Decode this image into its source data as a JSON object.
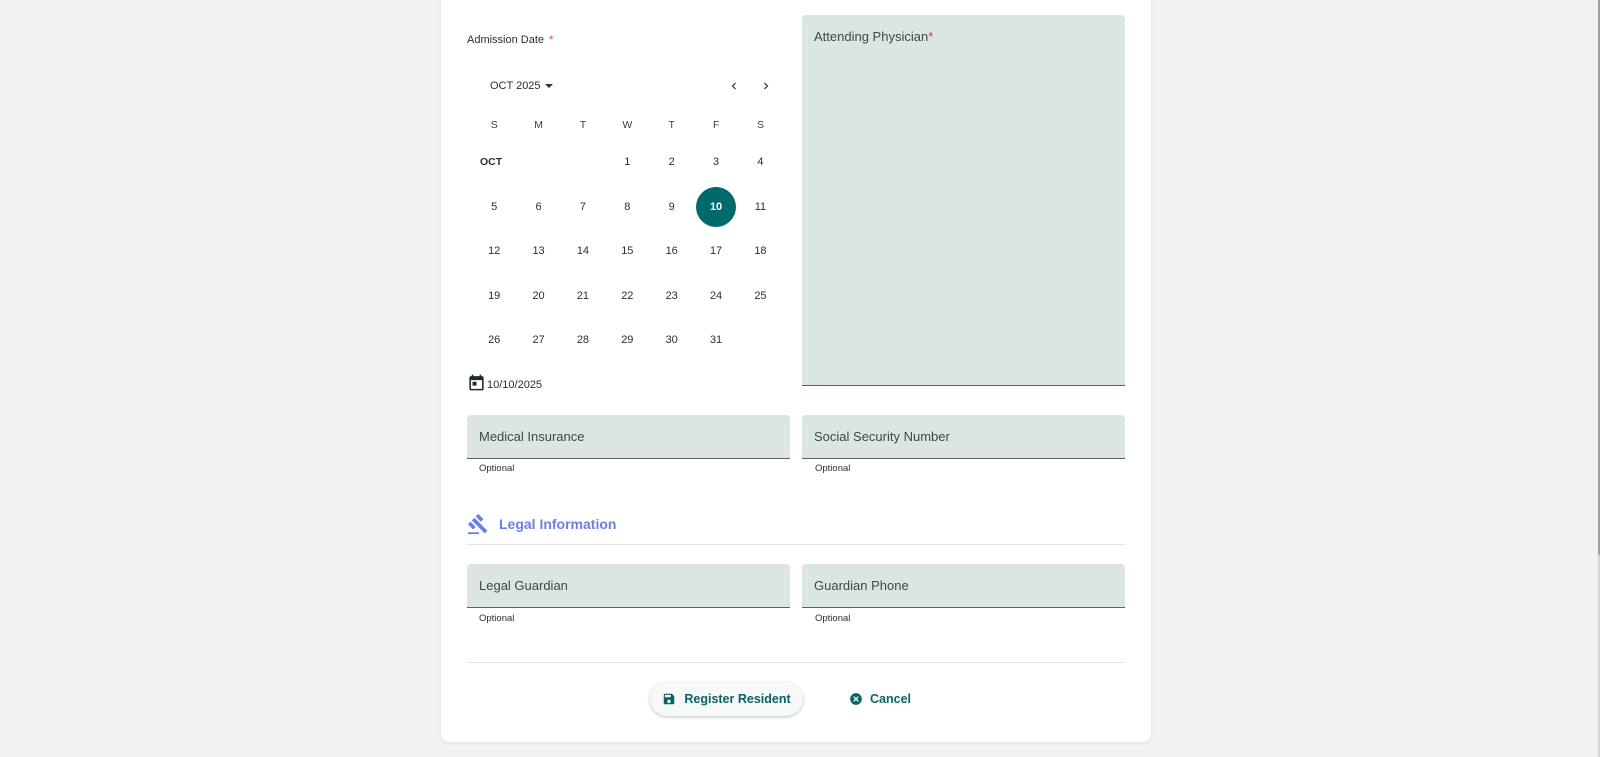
{
  "admission": {
    "label": "Admission Date",
    "required_mark": "*",
    "month_label": "OCT 2025",
    "month_tag": "OCT",
    "weekdays": [
      "S",
      "M",
      "T",
      "W",
      "T",
      "F",
      "S"
    ],
    "weeks": [
      [
        "",
        "",
        "",
        "1",
        "2",
        "3",
        "4"
      ],
      [
        "5",
        "6",
        "7",
        "8",
        "9",
        "10",
        "11"
      ],
      [
        "12",
        "13",
        "14",
        "15",
        "16",
        "17",
        "18"
      ],
      [
        "19",
        "20",
        "21",
        "22",
        "23",
        "24",
        "25"
      ],
      [
        "26",
        "27",
        "28",
        "29",
        "30",
        "31",
        ""
      ]
    ],
    "selected_day": "10",
    "value": "10/10/2025",
    "icons": {
      "prev": "chevron-left-icon",
      "next": "chevron-right-icon",
      "calendar": "calendar-icon",
      "dropdown": "caret-down-icon"
    }
  },
  "fields": {
    "attending_physician": {
      "label": "Attending Physician",
      "required_mark": "*"
    },
    "medical_insurance": {
      "label": "Medical Insurance",
      "helper": "Optional"
    },
    "ssn": {
      "label": "Social Security Number",
      "helper": "Optional"
    },
    "legal_guardian": {
      "label": "Legal Guardian",
      "helper": "Optional"
    },
    "guardian_phone": {
      "label": "Guardian Phone",
      "helper": "Optional"
    }
  },
  "legal_section": {
    "title": "Legal Information",
    "icon": "gavel-icon"
  },
  "actions": {
    "register": {
      "label": "Register Resident",
      "icon": "save-icon"
    },
    "cancel": {
      "label": "Cancel",
      "icon": "cancel-circle-icon"
    }
  },
  "colors": {
    "accent": "#00696b",
    "field_bg": "#dbe5e3",
    "section_title": "#6b7fe3",
    "required": "#e53935"
  }
}
